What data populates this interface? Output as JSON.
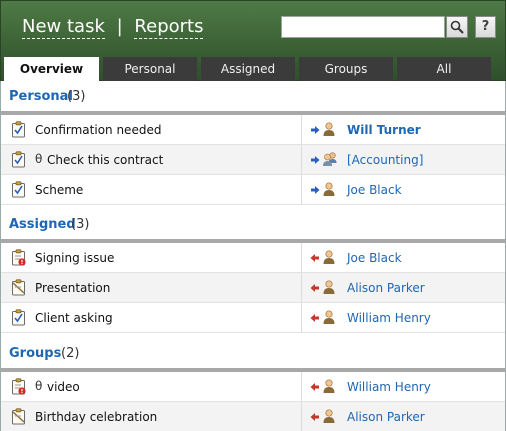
{
  "header": {
    "new_task": "New task",
    "separator": "|",
    "reports": "Reports",
    "search": {
      "value": "",
      "placeholder": ""
    },
    "help_label": "?"
  },
  "tabs": [
    {
      "label": "Overview",
      "active": true
    },
    {
      "label": "Personal",
      "active": false
    },
    {
      "label": "Assigned",
      "active": false
    },
    {
      "label": "Groups",
      "active": false
    },
    {
      "label": "All",
      "active": false
    }
  ],
  "sections": {
    "personal": {
      "title": "Personal",
      "count": "(3)",
      "rows": [
        {
          "task": "Confirmation needed",
          "attachment": false,
          "icon": "task-checked-icon",
          "direction": "outgoing",
          "assignee": "Will Turner",
          "assignee_bold": true,
          "assignee_type": "user"
        },
        {
          "task": "Check this contract",
          "attachment": true,
          "icon": "task-checked-icon",
          "direction": "outgoing",
          "assignee": "[Accounting]",
          "assignee_bold": false,
          "assignee_type": "group"
        },
        {
          "task": "Scheme",
          "attachment": false,
          "icon": "task-checked-icon",
          "direction": "outgoing",
          "assignee": "Joe Black",
          "assignee_bold": false,
          "assignee_type": "user"
        }
      ]
    },
    "assigned": {
      "title": "Assigned",
      "count": "(3)",
      "rows": [
        {
          "task": "Signing issue",
          "attachment": false,
          "icon": "task-alert-icon",
          "direction": "incoming",
          "assignee": "Joe Black",
          "assignee_bold": false,
          "assignee_type": "user"
        },
        {
          "task": "Presentation",
          "attachment": false,
          "icon": "task-note-icon",
          "direction": "incoming",
          "assignee": "Alison Parker",
          "assignee_bold": false,
          "assignee_type": "user"
        },
        {
          "task": "Client asking",
          "attachment": false,
          "icon": "task-checked-icon",
          "direction": "incoming",
          "assignee": "William Henry",
          "assignee_bold": false,
          "assignee_type": "user"
        }
      ]
    },
    "groups": {
      "title": "Groups",
      "count": "(2)",
      "rows": [
        {
          "task": "video",
          "attachment": true,
          "icon": "task-alert-icon",
          "direction": "incoming",
          "assignee": "William Henry",
          "assignee_bold": false,
          "assignee_type": "user"
        },
        {
          "task": "Birthday celebration",
          "attachment": false,
          "icon": "task-note-icon",
          "direction": "incoming",
          "assignee": "Alison Parker",
          "assignee_bold": false,
          "assignee_type": "user"
        }
      ]
    }
  },
  "attachment_glyph": "θ",
  "colors": {
    "header_green": "#3c6236",
    "link_blue": "#1f66b3",
    "outgoing_arrow": "#2a5fc0",
    "incoming_arrow": "#c0392b"
  }
}
